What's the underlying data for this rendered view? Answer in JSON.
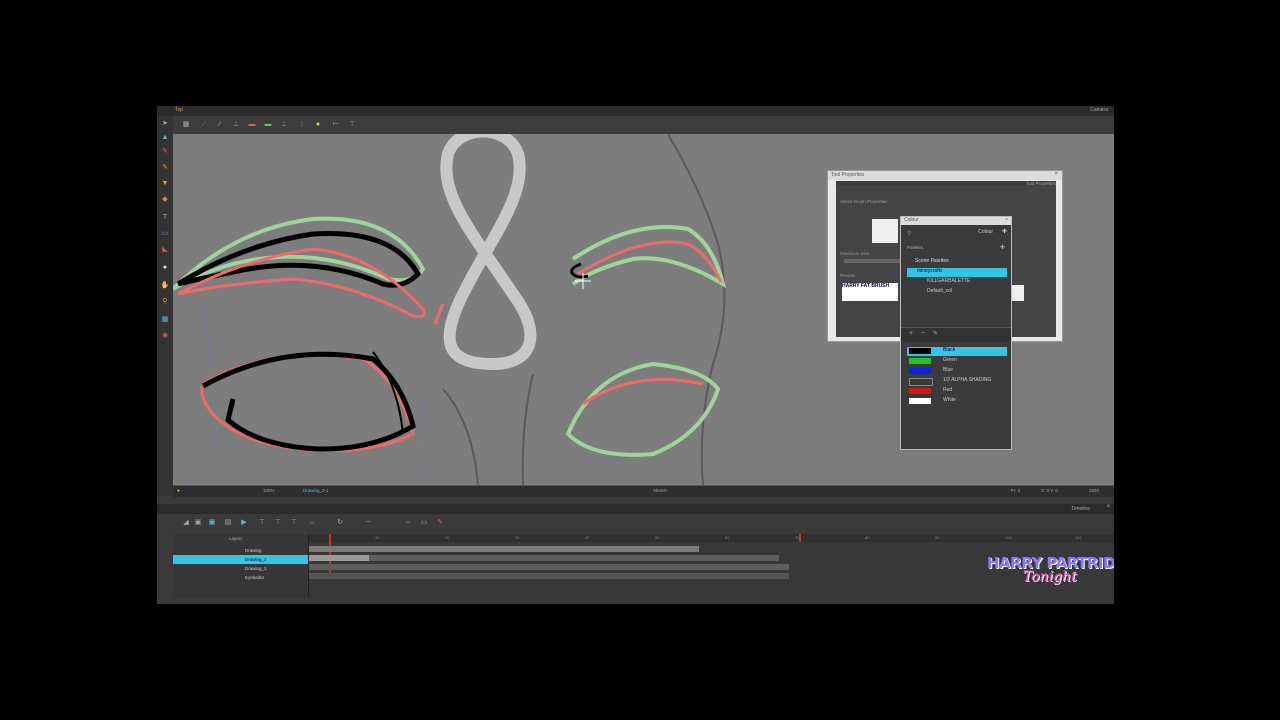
{
  "camera": {
    "tab_label": "Top",
    "view_label": "Camera",
    "status_zoom": "100%",
    "status_drawing": "Drawing_2-1",
    "status_center": "Sketch",
    "status_frame": "Fr: 3",
    "status_coords": "X: 0  Y: 0",
    "status_size": "1920"
  },
  "tool_properties": {
    "title": "Tool Properties",
    "tab": "Tool Properties",
    "section": "Vector Brush Properties",
    "label_max_size": "Maximum Size",
    "preset_label": "Presets",
    "preset_name": "HARRY FAT BRUSH",
    "preset_header": "HARRY FAT BRUSH"
  },
  "colour_panel": {
    "title": "Colour",
    "tab": "Colour",
    "palettes_header": "Palettes",
    "scene_palettes": "Scene Palettes",
    "palettes": [
      {
        "name": "mineycrafts",
        "selected": true
      },
      {
        "name": "KILLGARBALETTE",
        "selected": false
      },
      {
        "name": "Default_col",
        "selected": false
      }
    ],
    "colours": [
      {
        "name": "Black",
        "hex": "#000000",
        "selected": true
      },
      {
        "name": "Green",
        "hex": "#1fc72c"
      },
      {
        "name": "Blue",
        "hex": "#1020e0"
      },
      {
        "name": "1/2 ALPHA SHADING",
        "hex": "#3a3a3a"
      },
      {
        "name": "Red",
        "hex": "#d01818"
      },
      {
        "name": "White",
        "hex": "#ffffff"
      }
    ]
  },
  "timeline": {
    "title": "Timeline",
    "layers_header": "Layers",
    "layers": [
      {
        "name": "Drawing",
        "selected": false
      },
      {
        "name": "Drawing_2",
        "selected": true
      },
      {
        "name": "Drawing_3",
        "selected": false
      },
      {
        "name": "Eyeballs1",
        "selected": false
      }
    ],
    "ruler": [
      "10",
      "20",
      "30",
      "40",
      "50",
      "60",
      "70",
      "80",
      "90",
      "100",
      "110",
      "120"
    ]
  },
  "logo": {
    "line1": "HARRY PARTRIDGE",
    "line2": "Tonight"
  },
  "colors": {
    "accent": "#33c4e8",
    "canvas": "#7d7d7d",
    "stroke_green": "#9fd49a",
    "stroke_red": "#ef6b6b",
    "logo_purple": "#8b7fe0",
    "logo_pink": "#e85fc8"
  }
}
